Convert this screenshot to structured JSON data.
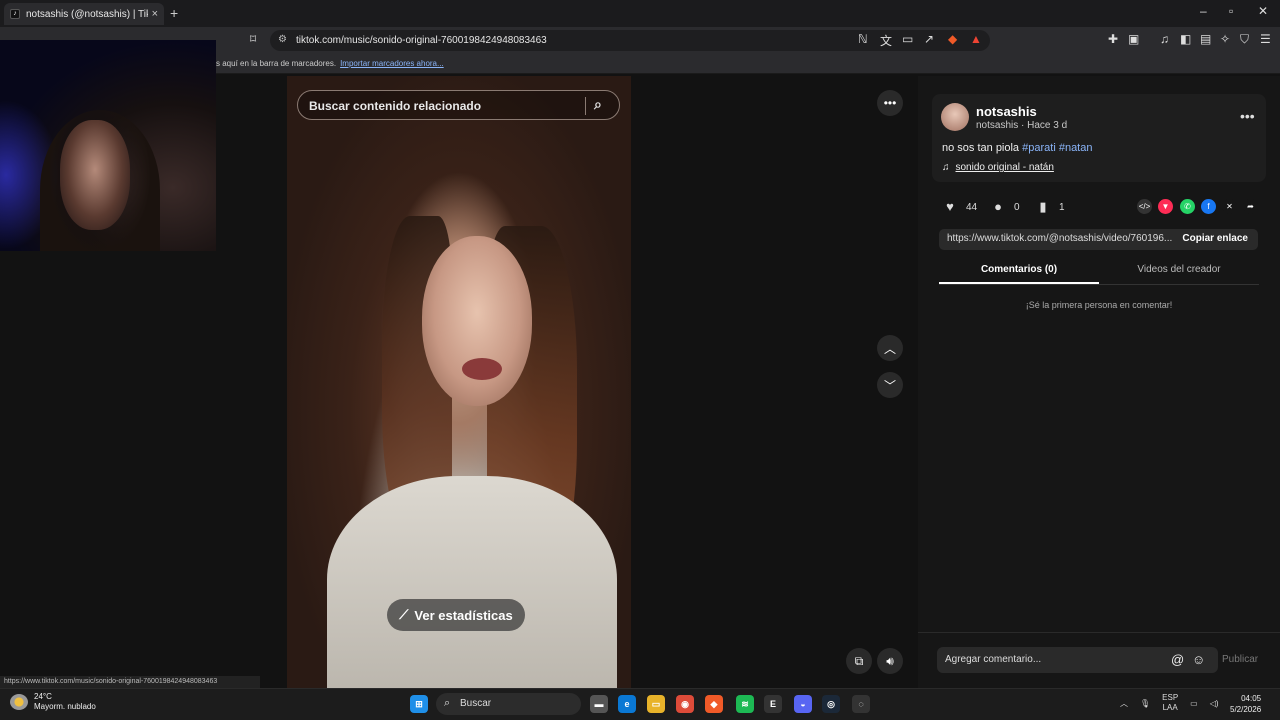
{
  "browser": {
    "tab_title": "notsashis (@notsashis) | TikTo",
    "tab_close": "×",
    "new_tab": "+",
    "url": "tiktok.com/music/sonido-original-7600198424948083463",
    "bookmarks_text": "s aquí en la barra de marcadores.",
    "bookmarks_link": "Importar marcadores ahora...",
    "status_url": "https://www.tiktok.com/music/sonido-original-7600198424948083463"
  },
  "video": {
    "search_placeholder": "Buscar contenido relacionado",
    "stats_label": "Ver estadísticas"
  },
  "post": {
    "username": "notsashis",
    "subline": "notsashis · Hace 3 d",
    "description": "no sos tan piola ",
    "hashtags": [
      "#parati",
      "#natan"
    ],
    "music": "sonido original - natán",
    "likes": "44",
    "comments": "0",
    "saves": "1",
    "share_link": "https://www.tiktok.com/@notsashis/video/760196...",
    "copy_label": "Copiar enlace",
    "tab_comments": "Comentarios (0)",
    "tab_creator": "Videos del creador",
    "empty_comments": "¡Sé la primera persona en comentar!",
    "comment_placeholder": "Agregar comentario...",
    "publish_label": "Publicar"
  },
  "taskbar": {
    "temperature": "24°C",
    "weather": "Mayorm. nublado",
    "search": "Buscar",
    "lang": "ESP",
    "lang_sub": "LAA",
    "time": "04:05",
    "date": "5/2/2026"
  },
  "colors": {
    "hashtag": "#8ab4f8",
    "background": "#121212",
    "panel": "#161616"
  }
}
